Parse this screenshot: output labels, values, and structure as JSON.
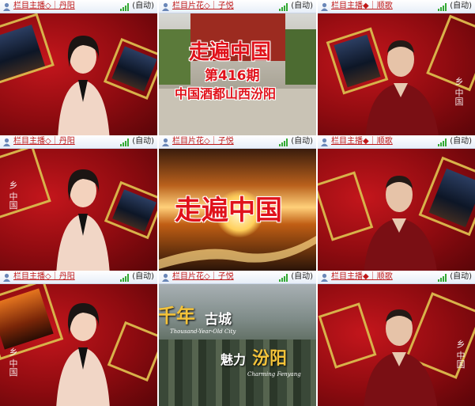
{
  "cells": [
    {
      "title": "栏目主播◇｜丹阳",
      "status": "(自动)"
    },
    {
      "title": "栏目片花◇｜子悦",
      "status": "(自动)"
    },
    {
      "title": "栏目主播◆｜顺歌",
      "status": "(自动)"
    },
    {
      "title": "栏目主播◇｜丹阳",
      "status": "(自动)"
    },
    {
      "title": "栏目片花◇｜子悦",
      "status": "(自动)"
    },
    {
      "title": "栏目主播◆｜顺歌",
      "status": "(自动)"
    },
    {
      "title": "栏目主播◇｜丹阳",
      "status": "(自动)"
    },
    {
      "title": "栏目片花◇｜子悦",
      "status": "(自动)"
    },
    {
      "title": "栏目主播◆｜顺歌",
      "status": "(自动)"
    }
  ],
  "videos": {
    "v1": {
      "line1": "走遍中国",
      "line2": "第416期",
      "line3": "中国酒都山西汾阳"
    },
    "v4": {
      "line1": "走遍中国"
    },
    "v7": {
      "line1": "千年",
      "line2": "古城",
      "line3": "Thousand-Year-Old  City",
      "line4": "魅力",
      "line5": "汾阳",
      "line6": "Charming Fenyang"
    }
  },
  "icons": {
    "user": "user-avatar-icon",
    "signal": "signal-strength-icon"
  },
  "colors": {
    "title_red": "#c01818",
    "accent_gold": "#d8b24a",
    "backdrop_red": "#c4161c",
    "header_bg": "#e7eef8"
  }
}
